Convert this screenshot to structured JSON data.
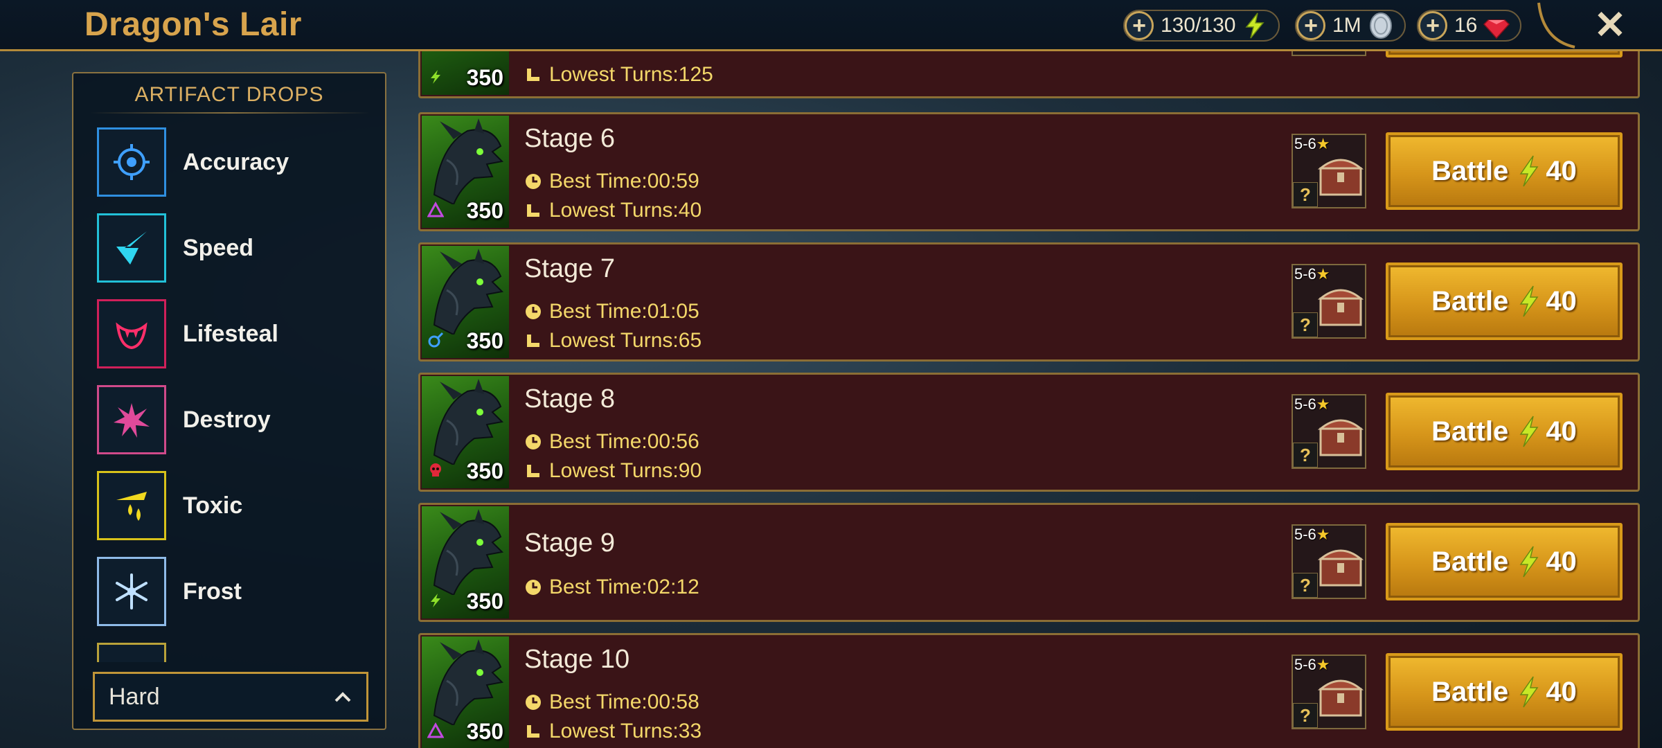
{
  "header": {
    "title": "Dragon's Lair",
    "energy": "130/130",
    "silver": "1M",
    "gems": "16",
    "close_glyph": "✕"
  },
  "artifact_panel": {
    "heading": "ARTIFACT DROPS",
    "sets": [
      {
        "label": "Accuracy",
        "icon": "accuracy-icon",
        "color": "#2f8fe0"
      },
      {
        "label": "Speed",
        "icon": "speed-icon",
        "color": "#22c1d8"
      },
      {
        "label": "Lifesteal",
        "icon": "lifesteal-icon",
        "color": "#d0205a"
      },
      {
        "label": "Destroy",
        "icon": "destroy-icon",
        "color": "#d04a8a"
      },
      {
        "label": "Toxic",
        "icon": "toxic-icon",
        "color": "#d8c21a"
      },
      {
        "label": "Frost",
        "icon": "frost-icon",
        "color": "#8fbbe8"
      }
    ],
    "difficulty": "Hard"
  },
  "stages": [
    {
      "name": "",
      "power": "350",
      "affinity": "force",
      "best_time": "",
      "lowest_turns": "125"
    },
    {
      "name": "Stage 6",
      "power": "350",
      "affinity": "magic",
      "best_time": "00:59",
      "lowest_turns": "40",
      "rank": "5-6",
      "battle_label": "Battle",
      "cost": "40"
    },
    {
      "name": "Stage 7",
      "power": "350",
      "affinity": "spirit",
      "best_time": "01:05",
      "lowest_turns": "65",
      "rank": "5-6",
      "battle_label": "Battle",
      "cost": "40"
    },
    {
      "name": "Stage 8",
      "power": "350",
      "affinity": "void",
      "best_time": "00:56",
      "lowest_turns": "90",
      "rank": "5-6",
      "battle_label": "Battle",
      "cost": "40"
    },
    {
      "name": "Stage 9",
      "power": "350",
      "affinity": "force",
      "best_time": "02:12",
      "lowest_turns": "",
      "rank": "5-6",
      "battle_label": "Battle",
      "cost": "40"
    },
    {
      "name": "Stage 10",
      "power": "350",
      "affinity": "magic",
      "best_time": "00:58",
      "lowest_turns": "33",
      "rank": "5-6",
      "battle_label": "Battle",
      "cost": "40"
    }
  ],
  "labels": {
    "best_time": "Best Time: ",
    "lowest_turns": "Lowest Turns: ",
    "chest_question": "?"
  },
  "colors": {
    "accent_gold": "#d8a44d",
    "stage_bg": "#3a1417",
    "button": "#e2a521",
    "stat_yellow": "#f4d86a"
  }
}
